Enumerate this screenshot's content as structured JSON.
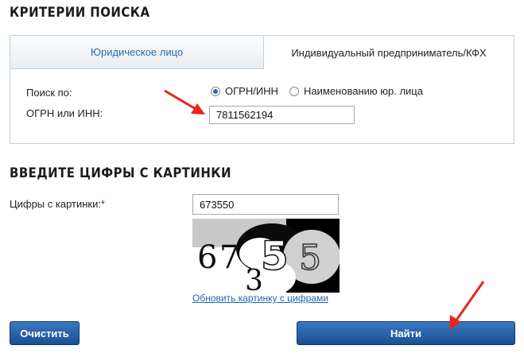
{
  "sections": {
    "criteria_title": "КРИТЕРИИ ПОИСКА",
    "captcha_title": "ВВЕДИТЕ ЦИФРЫ С КАРТИНКИ"
  },
  "tabs": [
    {
      "label": "Юридическое лицо",
      "active": true
    },
    {
      "label": "Индивидуальный предприниматель/КФХ",
      "active": false
    }
  ],
  "search": {
    "search_by_label": "Поиск по:",
    "options": [
      {
        "label": "ОГРН/ИНН",
        "checked": true
      },
      {
        "label": "Наименованию юр. лица",
        "checked": false
      }
    ],
    "ogrn_inn_label": "ОГРН или ИНН:",
    "ogrn_inn_value": "7811562194"
  },
  "captcha": {
    "label": "Цифры с картинки:",
    "required_mark": "*",
    "value": "673550",
    "image_digits": [
      "6",
      "7",
      "3",
      "5",
      "5"
    ],
    "refresh_link": "Обновить картинку с цифрами"
  },
  "buttons": {
    "clear": "Очистить",
    "find": "Найти"
  },
  "colors": {
    "accent_blue": "#1b4f90",
    "tab_text": "#2a6aa0",
    "annotation_arrow": "#e8261c",
    "link": "#1f66b5"
  }
}
